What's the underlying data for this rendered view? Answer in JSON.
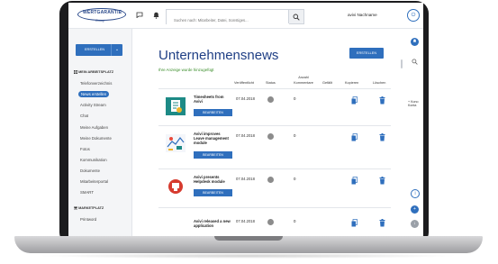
{
  "header": {
    "logo_text": "WERTGARANTIE",
    "logo_sub": "Group",
    "search_placeholder": "Suchen nach: Mitarbeiter, Datei, Sonstiges...",
    "user_name": "avivi Nachname"
  },
  "sidebar": {
    "create_label": "ERSTELLEN",
    "section_1": "MEIN ARBEITSPLATZ",
    "items": [
      {
        "label": "Telefonverzeichnis"
      },
      {
        "label": "News erstellen"
      },
      {
        "label": "Activity Stream"
      },
      {
        "label": "Chat"
      },
      {
        "label": "Meine Aufgaben"
      },
      {
        "label": "Meine Dokumente"
      },
      {
        "label": "Fotos"
      },
      {
        "label": "Kommunikation"
      },
      {
        "label": "Dokumente"
      },
      {
        "label": "Mitarbeiterportal"
      },
      {
        "label": "SMART"
      }
    ],
    "section_2": "MARKETPLATZ",
    "items_2": [
      {
        "label": "Printword"
      }
    ]
  },
  "main": {
    "title": "Unternehmensnews",
    "create_label": "ERSTELLEN",
    "success_msg": "Ihre Anzeige wurde hinzugefügt",
    "columns": {
      "published": "Veröffentlicht",
      "status": "Status",
      "comments_line1": "Anzahl",
      "comments_line2": "Kommentare",
      "liked": "Gefällt",
      "copy": "Kopieren",
      "delete": "Löschen"
    },
    "edit_label": "BEARBEITEN",
    "rows": [
      {
        "title_1": "Timesheets from",
        "title_2": "Avivi",
        "title_3": "",
        "date": "07.04.2018",
        "comments": "0"
      },
      {
        "title_1": "Avivi improves",
        "title_2": "Leave management",
        "title_3": "module",
        "date": "07.04.2018",
        "comments": "0"
      },
      {
        "title_1": "Avivi presents",
        "title_2": "Helpdesk module",
        "title_3": "",
        "date": "07.04.2018",
        "comments": "0"
      },
      {
        "title_1": "Avivi released a new",
        "title_2": "application",
        "title_3": "",
        "date": "07.04.2018",
        "comments": "0"
      }
    ]
  },
  "right_rail": {
    "text_1": "+ Kono",
    "text_2": "Konta"
  },
  "colors": {
    "brand_blue": "#2f6fbd",
    "title_blue": "#1f3f85",
    "success_green": "#3a8d2a"
  }
}
